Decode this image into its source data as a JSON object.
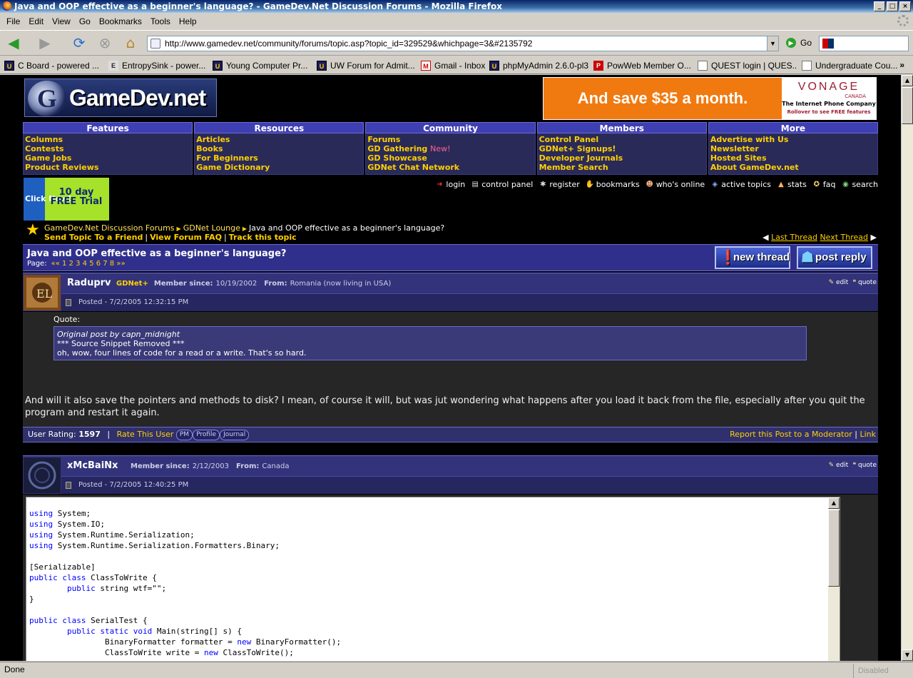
{
  "window": {
    "title": "Java and OOP effective as a beginner's language? - GameDev.Net Discussion Forums - Mozilla Firefox"
  },
  "menu": [
    "File",
    "Edit",
    "View",
    "Go",
    "Bookmarks",
    "Tools",
    "Help"
  ],
  "nav": {
    "url": "http://www.gamedev.net/community/forums/topic.asp?topic_id=329529&whichpage=3&#2135792",
    "go_label": "Go"
  },
  "bookmarks": [
    {
      "label": "C Board - powered ...",
      "icon": "u"
    },
    {
      "label": "EntropySink - power...",
      "icon": "e"
    },
    {
      "label": "Young Computer Pr...",
      "icon": "u"
    },
    {
      "label": "UW Forum for Admit...",
      "icon": "u"
    },
    {
      "label": "Gmail - Inbox",
      "icon": "g"
    },
    {
      "label": "phpMyAdmin 2.6.0-pl3",
      "icon": "u"
    },
    {
      "label": "PowWeb Member O...",
      "icon": "p"
    },
    {
      "label": "QUEST login | QUES...",
      "icon": "d"
    },
    {
      "label": "Undergraduate Cou...",
      "icon": "d"
    }
  ],
  "site": {
    "logo": "GameDev.net"
  },
  "ad": {
    "text": "And save $35 a month.",
    "brand": "VONAGE",
    "country": "CANADA",
    "tagline": "The Internet Phone Company",
    "rollover": "Rollover to see FREE features"
  },
  "navcols": [
    {
      "title": "Features",
      "links": [
        "Columns",
        "Contests",
        "Game Jobs",
        "Product Reviews"
      ]
    },
    {
      "title": "Resources",
      "links": [
        "Articles",
        "Books",
        "For Beginners",
        "Game Dictionary"
      ]
    },
    {
      "title": "Community",
      "links": [
        "Forums",
        "GD Gathering",
        "GD Showcase",
        "GDNet Chat Network"
      ],
      "new": "New!"
    },
    {
      "title": "Members",
      "links": [
        "Control Panel",
        "GDNet+ Signups!",
        "Developer Journals",
        "Member Search"
      ]
    },
    {
      "title": "More",
      "links": [
        "Advertise with Us",
        "Newsletter",
        "Hosted Sites",
        "About GameDev.net"
      ]
    }
  ],
  "trial": {
    "click": "Click Now!",
    "days": "10 day FREE Trial"
  },
  "toplinks": [
    "login",
    "control panel",
    "register",
    "bookmarks",
    "who's online",
    "active topics",
    "stats",
    "faq",
    "search"
  ],
  "crumbs": {
    "forum": "GameDev.Net Discussion Forums",
    "sub": "GDNet Lounge",
    "topic": "Java and OOP effective as a beginner's language?",
    "send": "Send Topic To a Friend",
    "faq": "View Forum FAQ",
    "track": "Track this topic",
    "last": "Last Thread",
    "next": "Next Thread"
  },
  "topic": {
    "title": "Java and OOP effective as a beginner's language?",
    "page_label": "Page:",
    "pages": "«« 1 2 3 4 5 6 7 8 »»",
    "new_thread": "new thread",
    "post_reply": "post reply"
  },
  "posts": [
    {
      "name": "Raduprv",
      "badge": "GDNet+",
      "since_label": "Member since:",
      "since": "10/19/2002",
      "from_label": "From:",
      "from": "Romania (now living in USA)",
      "posted": "Posted - 7/2/2005 12:32:15 PM",
      "quote_label": "Quote:",
      "quote_author": "Original post by capn_midnight",
      "quote_l1": "*** Source Snippet Removed ***",
      "quote_l2": "oh, wow, four lines of code for a read or a write. That's so hard.",
      "text": "And will it also save the pointers and methods to disk? I mean, of course it will, but was jut wondering what happens after you load it back from the file, especially after you quit the program and restart it again.",
      "rating_label": "User Rating:",
      "rating": "1597",
      "rate": "Rate This User",
      "pm": "PM",
      "profile": "Profile",
      "journal": "Journal",
      "report": "Report this Post to a Moderator",
      "link": "Link"
    },
    {
      "name": "xMcBaiNx",
      "since_label": "Member since:",
      "since": "2/12/2003",
      "from_label": "From:",
      "from": "Canada",
      "posted": "Posted - 7/2/2005 12:40:25 PM"
    }
  ],
  "actions": {
    "edit": "edit",
    "quote": "quote"
  },
  "status": {
    "text": "Done",
    "right": "Disabled"
  }
}
